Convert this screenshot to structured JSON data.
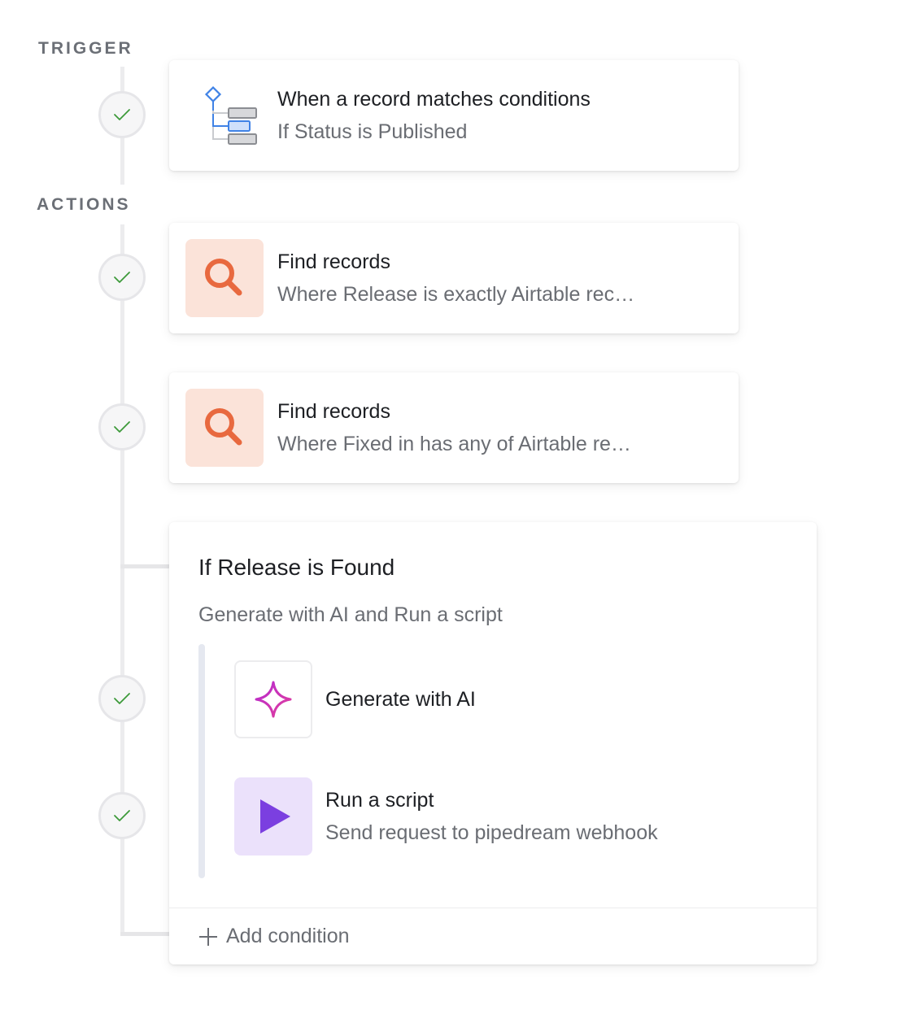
{
  "labels": {
    "trigger": "TRIGGER",
    "actions": "ACTIONS"
  },
  "trigger": {
    "icon": "conditions-tree-icon",
    "title": "When a record matches conditions",
    "subtitle": "If Status is Published",
    "status": "complete"
  },
  "actions": [
    {
      "icon": "search-icon",
      "title": "Find records",
      "subtitle": "Where Release is exactly Airtable rec…",
      "status": "complete"
    },
    {
      "icon": "search-icon",
      "title": "Find records",
      "subtitle": "Where Fixed in has any of Airtable re…",
      "status": "complete"
    }
  ],
  "condition_group": {
    "title": "If Release is Found",
    "subtitle": "Generate with AI and Run a script",
    "steps": [
      {
        "icon": "sparkle-icon",
        "title": "Generate with AI",
        "subtitle": "",
        "status": "complete"
      },
      {
        "icon": "play-icon",
        "title": "Run a script",
        "subtitle": "Send request to pipedream webhook",
        "status": "complete"
      }
    ],
    "add_condition_label": "Add condition"
  },
  "colors": {
    "check": "#3d9a3a",
    "search_icon": "#e8693f",
    "search_bg": "#fbe3d9",
    "play_icon": "#7b3fe0",
    "play_bg": "#ebe1fb",
    "sparkle_start": "#b52ad1",
    "sparkle_end": "#e23e9b",
    "trigger_blue": "#3f82e6"
  }
}
